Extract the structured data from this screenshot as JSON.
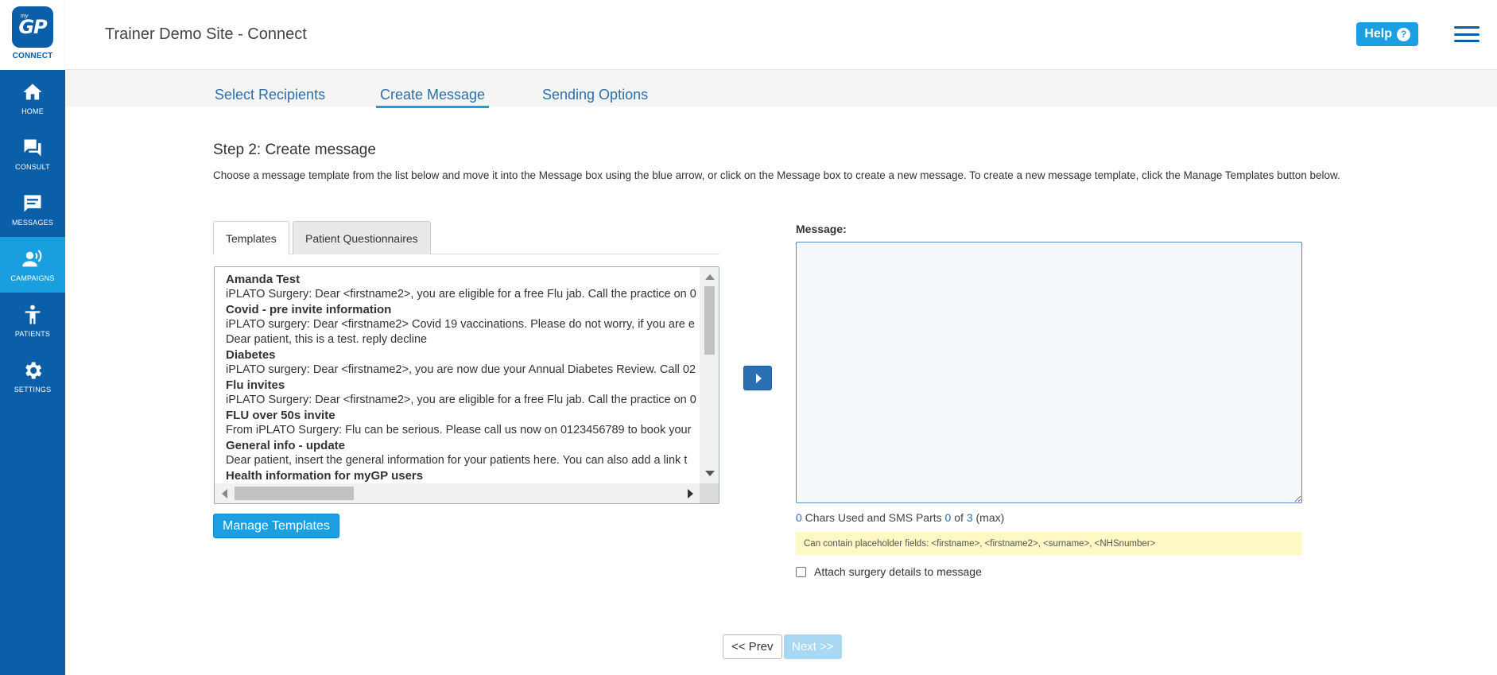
{
  "sidebar": {
    "logo": {
      "brand": "GP",
      "prefix": "my",
      "subtitle": "CONNECT"
    },
    "items": [
      {
        "label": "HOME",
        "icon": "home-icon"
      },
      {
        "label": "CONSULT",
        "icon": "consult-icon"
      },
      {
        "label": "MESSAGES",
        "icon": "messages-icon"
      },
      {
        "label": "CAMPAIGNS",
        "icon": "campaigns-icon",
        "active": true
      },
      {
        "label": "PATIENTS",
        "icon": "patients-icon"
      },
      {
        "label": "SETTINGS",
        "icon": "gear-icon"
      }
    ]
  },
  "header": {
    "title": "Trainer Demo Site - Connect",
    "help_label": "Help",
    "help_icon": "?"
  },
  "step_tabs": [
    {
      "label": "Select Recipients"
    },
    {
      "label": "Create Message",
      "active": true
    },
    {
      "label": "Sending Options"
    }
  ],
  "main": {
    "step_title": "Step 2: Create message",
    "description": "Choose a message template from the list below and move it into the Message box using the blue arrow, or click on the Message box to create a new message. To create a new message template, click the Manage Templates button below."
  },
  "template_tabs": [
    {
      "label": "Templates",
      "active": true
    },
    {
      "label": "Patient Questionnaires"
    }
  ],
  "templates": {
    "lines": [
      {
        "type": "group",
        "text": "Amanda Test"
      },
      {
        "type": "item",
        "text": "iPLATO Surgery: Dear <firstname2>, you are eligible for a free Flu jab. Call the practice on 0"
      },
      {
        "type": "group",
        "text": "Covid - pre invite information"
      },
      {
        "type": "item",
        "text": "iPLATO surgery: Dear <firstname2> Covid 19 vaccinations. Please do not worry, if you are e"
      },
      {
        "type": "item",
        "text": "Dear patient, this is a test. reply decline"
      },
      {
        "type": "group",
        "text": "Diabetes"
      },
      {
        "type": "item",
        "text": "iPLATO surgery: Dear <firstname2>, you are now due your Annual Diabetes Review. Call 02"
      },
      {
        "type": "group",
        "text": "Flu invites"
      },
      {
        "type": "item",
        "text": "iPLATO Surgery: Dear <firstname2>, you are eligible for a free Flu jab. Call the practice on 0"
      },
      {
        "type": "group",
        "text": "FLU over 50s invite"
      },
      {
        "type": "item",
        "text": "From iPLATO Surgery: Flu can be serious. Please call us now on 0123456789 to book your"
      },
      {
        "type": "group",
        "text": "General info - update"
      },
      {
        "type": "item",
        "text": "Dear patient, insert the general information for your patients here. You can also add a link t"
      },
      {
        "type": "group",
        "text": "Health information for myGP users"
      }
    ],
    "manage_label": "Manage Templates"
  },
  "message": {
    "label": "Message:",
    "value": "",
    "chars_used": "0",
    "chars_text": " Chars Used and SMS Parts ",
    "parts_used": "0",
    "parts_of": " of ",
    "parts_max": "3",
    "parts_suffix": " (max)",
    "placeholder_note": "Can contain placeholder fields: <firstname>, <firstname2>, <surname>, <NHSnumber>",
    "attach_label": "Attach surgery details to message"
  },
  "navigation": {
    "prev_label": "<< Prev",
    "next_label": "Next >>"
  },
  "colors": {
    "sidebar": "#0b5ea8",
    "accent": "#1c9fe1",
    "active_nav": "#199fe0"
  }
}
